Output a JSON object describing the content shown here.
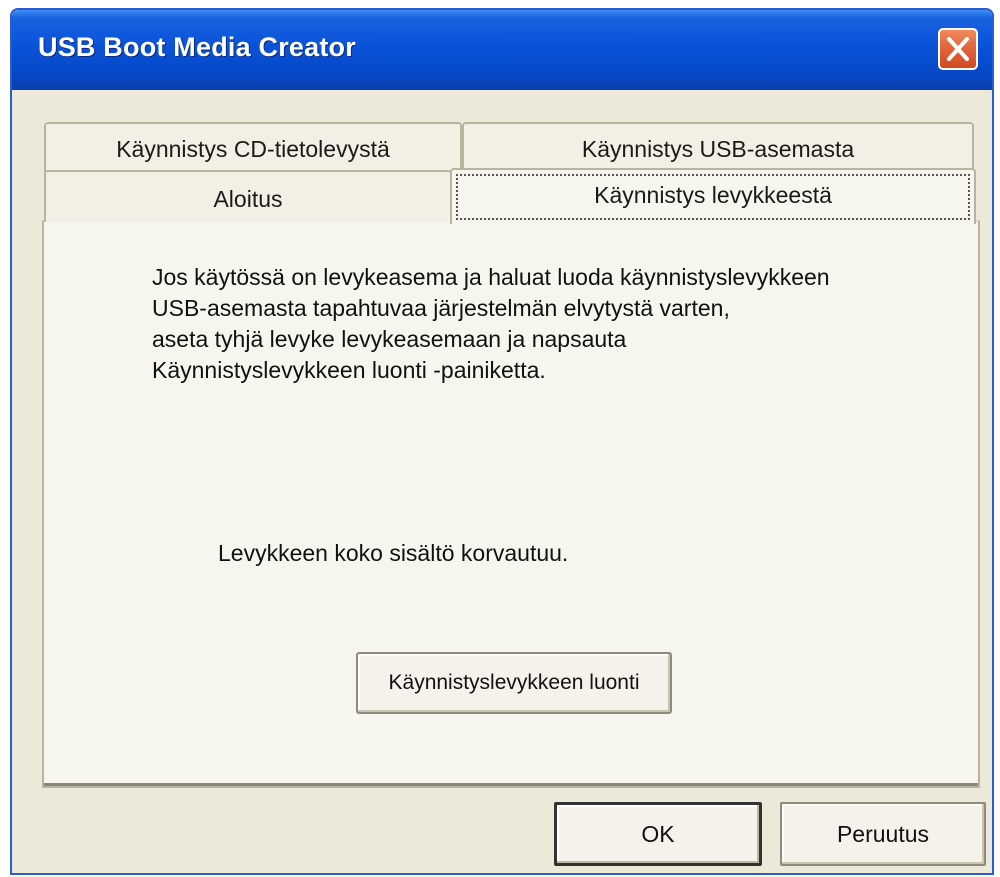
{
  "window": {
    "title": "USB Boot Media Creator",
    "close_icon": "close-x-icon"
  },
  "tabs": {
    "row_back": [
      {
        "label": "Käynnistys CD-tietolevystä",
        "selected": false
      },
      {
        "label": "Käynnistys USB-asemasta",
        "selected": false
      }
    ],
    "row_front": [
      {
        "label": "Aloitus",
        "selected": false
      },
      {
        "label": "Käynnistys levykkeestä",
        "selected": true
      }
    ]
  },
  "panel": {
    "instructions": "Jos käytössä on levykeasema  ja haluat luoda käynnistyslevykkeen\nUSB-asemasta tapahtuvaa järjestelmän elvytystä varten,\naseta tyhjä levyke levykeasemaan ja napsauta\nKäynnistyslevykkeen luonti -painiketta.",
    "warning": "Levykkeen koko sisältö korvautuu.",
    "create_button_label": "Käynnistyslevykkeen luonti"
  },
  "footer": {
    "ok_label": "OK",
    "cancel_label": "Peruutus"
  },
  "colors": {
    "titlebar": "#0a52d8",
    "window_bg": "#ece9d8",
    "panel_bg": "#f7f6ee",
    "close_button": "#e0633a"
  }
}
